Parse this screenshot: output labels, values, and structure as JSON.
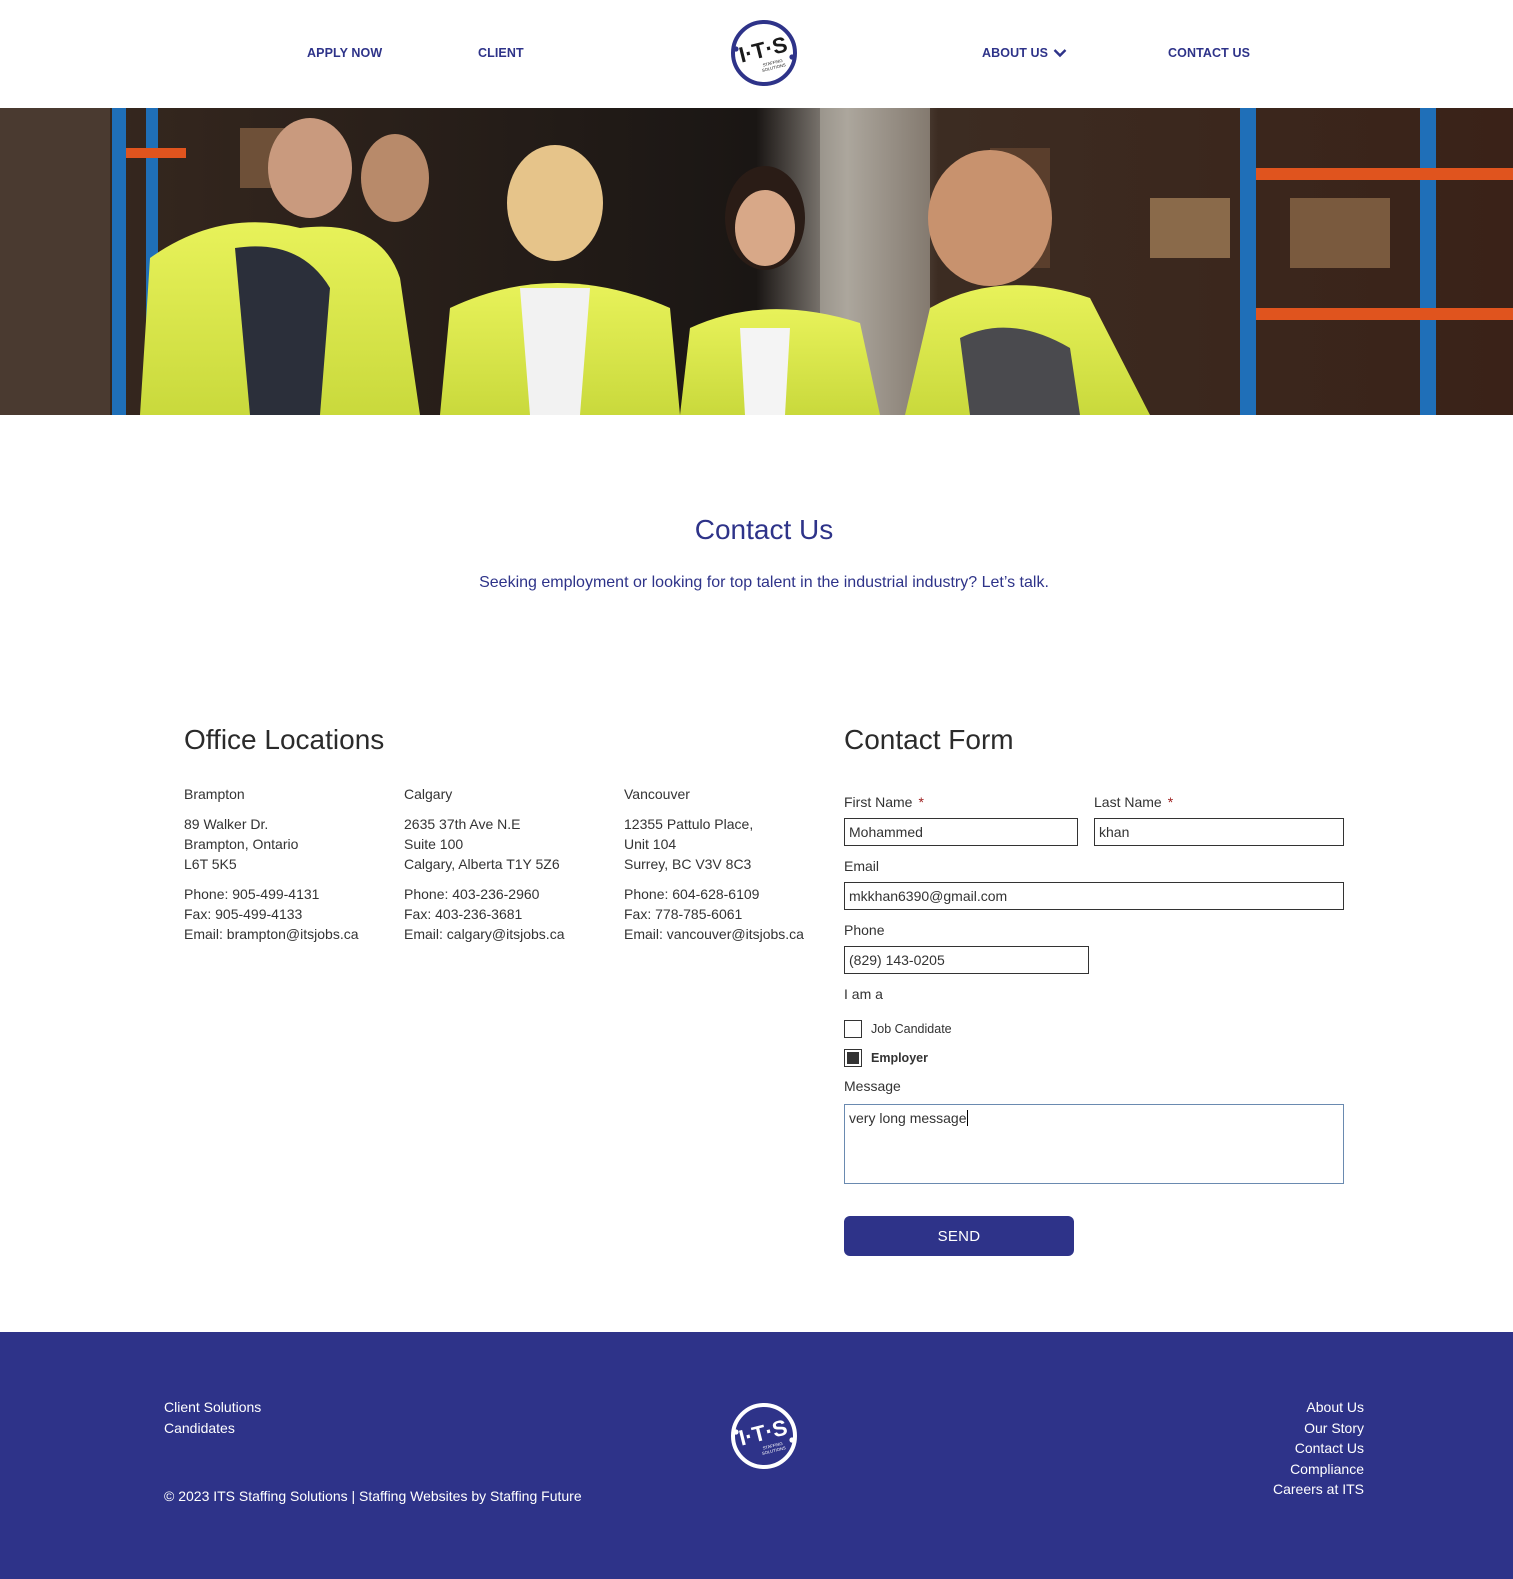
{
  "nav": {
    "apply": "APPLY NOW",
    "client": "CLIENT",
    "about": "ABOUT US",
    "contact": "CONTACT US"
  },
  "logo": {
    "text": "ITS",
    "tagline": "STAFFING SOLUTIONS",
    "color": "#2e3389"
  },
  "hero": {
    "description": "Five workers in high-visibility yellow vests in a warehouse aisle"
  },
  "intro": {
    "title": "Contact Us",
    "subtitle": "Seeking employment or looking for top talent in the industrial industry? Let’s talk."
  },
  "offices": {
    "heading": "Office Locations",
    "list": [
      {
        "city": "Brampton",
        "addr1": "89 Walker Dr.",
        "addr2": "Brampton, Ontario",
        "addr3": "L6T 5K5",
        "phone": "Phone: 905-499-4131",
        "fax": "Fax: 905-499-4133",
        "email": "Email: brampton@itsjobs.ca"
      },
      {
        "city": "Calgary",
        "addr1": "2635 37th Ave N.E",
        "addr2": "Suite 100",
        "addr3": "Calgary, Alberta T1Y 5Z6",
        "phone": "Phone: 403-236-2960",
        "fax": "Fax: 403-236-3681",
        "email": "Email: calgary@itsjobs.ca"
      },
      {
        "city": "Vancouver",
        "addr1": "12355 Pattulo Place,",
        "addr2": "Unit 104",
        "addr3": "Surrey, BC V3V 8C3",
        "phone": "Phone: 604-628-6109",
        "fax": "Fax: 778-785-6061",
        "email": "Email: vancouver@itsjobs.ca"
      }
    ]
  },
  "form": {
    "heading": "Contact Form",
    "first_name_label": "First Name",
    "first_name_value": "Mohammed",
    "last_name_label": "Last Name",
    "last_name_value": "khan",
    "required_mark": "*",
    "email_label": "Email",
    "email_value": "mkkhan6390@gmail.com",
    "phone_label": "Phone",
    "phone_value": "(829) 143-0205",
    "iam_label": "I am a",
    "options": [
      {
        "label": "Job Candidate",
        "checked": false
      },
      {
        "label": "Employer",
        "checked": true
      }
    ],
    "message_label": "Message",
    "message_value": "very long message",
    "send_label": "SEND"
  },
  "footer": {
    "left_links": [
      "Client Solutions",
      "Candidates"
    ],
    "right_links": [
      "About Us",
      "Our Story",
      "Contact Us",
      "Compliance",
      "Careers at ITS"
    ],
    "copyright": "© 2023 ITS Staffing Solutions | Staffing Websites by Staffing Future",
    "bg_color": "#2e3389"
  }
}
